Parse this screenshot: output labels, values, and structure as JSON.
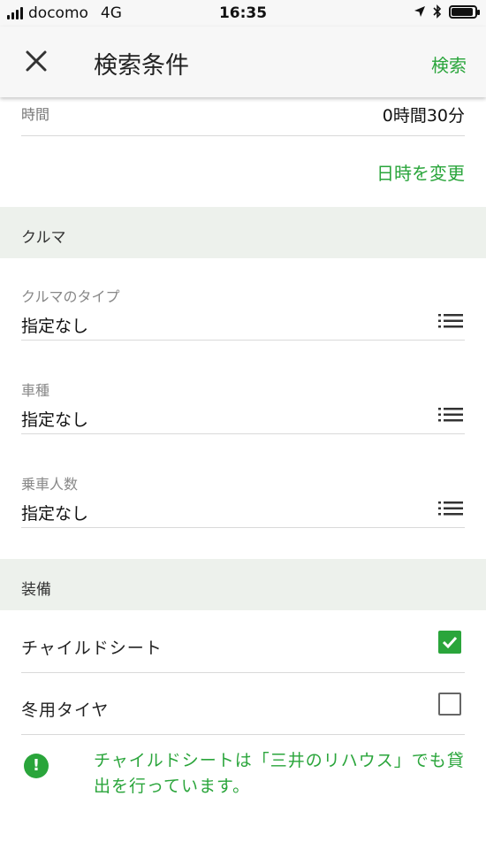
{
  "status_bar": {
    "carrier": "docomo",
    "network": "4G",
    "time": "16:35"
  },
  "header": {
    "title": "検索条件",
    "search_label": "検索",
    "close_icon": "close-icon"
  },
  "time_row": {
    "label": "時間",
    "value": "0時間30分"
  },
  "change_datetime_label": "日時を変更",
  "sections": {
    "car": {
      "title": "クルマ"
    },
    "equipment": {
      "title": "装備"
    }
  },
  "fields": [
    {
      "label": "クルマのタイプ",
      "value": "指定なし",
      "icon": "list-icon"
    },
    {
      "label": "車種",
      "value": "指定なし",
      "icon": "list-icon"
    },
    {
      "label": "乗車人数",
      "value": "指定なし",
      "icon": "list-icon"
    }
  ],
  "equipment": [
    {
      "label": "チャイルドシート",
      "checked": true
    },
    {
      "label": "冬用タイヤ",
      "checked": false
    }
  ],
  "notice": {
    "icon": "!",
    "text": "チャイルドシートは「三井のリハウス」でも貸出を行っています。"
  },
  "colors": {
    "accent": "#2aa53b",
    "section_bg": "#edf1ec",
    "header_bg": "#f7f7f7"
  }
}
